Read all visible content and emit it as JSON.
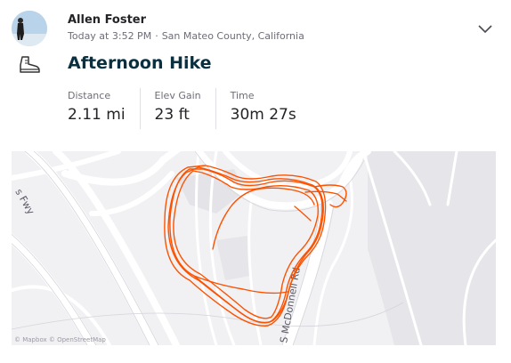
{
  "athlete": {
    "name": "Allen Foster",
    "avatar_icon": "avatar-photo"
  },
  "activity": {
    "time": "Today at 3:52 PM",
    "separator": "·",
    "location": "San Mateo County, California",
    "sport_icon": "hiking-boot-icon",
    "title": "Afternoon Hike"
  },
  "stats": [
    {
      "label": "Distance",
      "value": "2.11 mi"
    },
    {
      "label": "Elev Gain",
      "value": "23 ft"
    },
    {
      "label": "Time",
      "value": "30m 27s"
    }
  ],
  "map": {
    "road_labels": {
      "freeway": "s Fwy",
      "mcdonnell": "S McDonnell Rd"
    },
    "route_color": "#fc5200",
    "attribution": "© Mapbox © OpenStreetMap"
  },
  "menu": {
    "icon": "chevron-down-icon"
  }
}
